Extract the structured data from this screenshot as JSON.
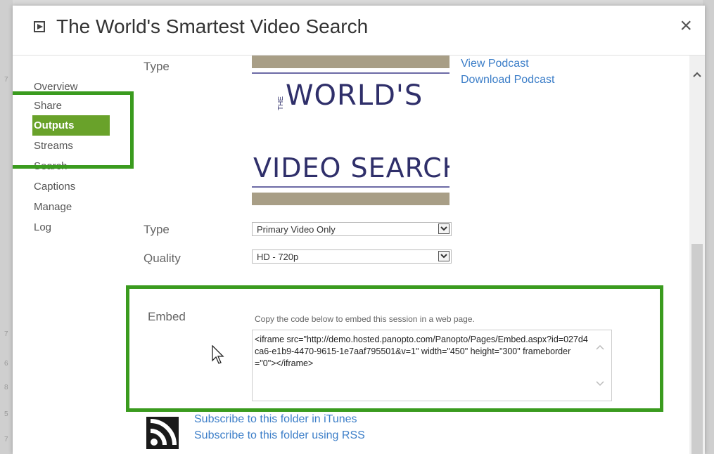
{
  "dialog": {
    "title": "The World's Smartest Video Search",
    "close_label": "×"
  },
  "nav": {
    "items": [
      "Overview",
      "Share",
      "Outputs",
      "Streams",
      "Search",
      "Captions",
      "Manage",
      "Log"
    ],
    "active": "Outputs"
  },
  "podcast": {
    "type_label": "Type",
    "view_link": "View Podcast",
    "download_link": "Download Podcast",
    "thumbnail_text_the": "THE",
    "thumbnail_text_line1": "WORLD'S",
    "thumbnail_text_line2": "VIDEO SEARCH"
  },
  "settings": {
    "type_label": "Type",
    "type_value": "Primary Video Only",
    "quality_label": "Quality",
    "quality_value": "HD - 720p"
  },
  "embed": {
    "label": "Embed",
    "description": "Copy the code below to embed this session in a web page.",
    "code": "<iframe src=\"http://demo.hosted.panopto.com/Panopto/Pages/Embed.aspx?id=027d4ca6-e1b9-4470-9615-1e7aaf795501&v=1\" width=\"450\" height=\"300\" frameborder=\"0\"></iframe>"
  },
  "subscribe": {
    "itunes_link": "Subscribe to this folder in iTunes",
    "rss_link": "Subscribe to this folder using RSS"
  },
  "highlight_color": "#3a9b1e",
  "accent_color": "#69a22a",
  "link_color": "#3c7ec8",
  "background_edge_numbers": [
    "7",
    "7",
    "6",
    "8",
    "5",
    "7"
  ]
}
